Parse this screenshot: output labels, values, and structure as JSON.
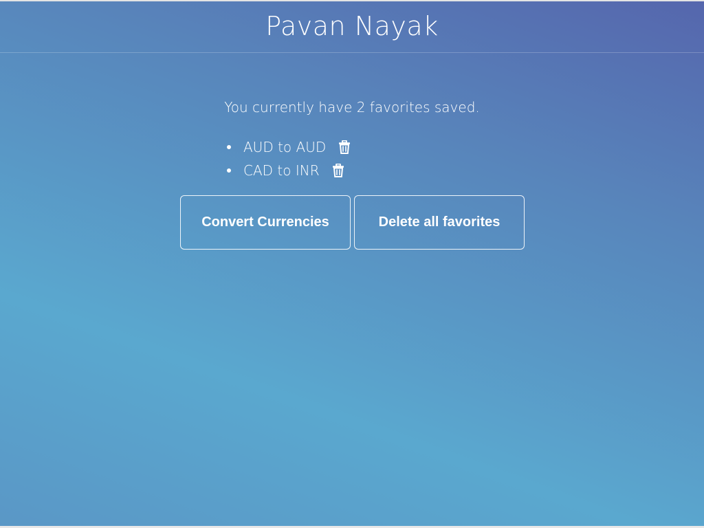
{
  "header": {
    "title": "Pavan Nayak"
  },
  "main": {
    "status_text": "You currently have 2 favorites saved.",
    "favorites": [
      {
        "label": "AUD to AUD",
        "icon": "trash-icon"
      },
      {
        "label": "CAD to INR",
        "icon": "trash-icon"
      }
    ],
    "buttons": {
      "convert_label": "Convert Currencies",
      "delete_all_label": "Delete all favorites"
    }
  },
  "colors": {
    "gradient_top_right": "#5566ad",
    "gradient_bottom_left": "#5aa8cf",
    "text": "#ffffff"
  }
}
